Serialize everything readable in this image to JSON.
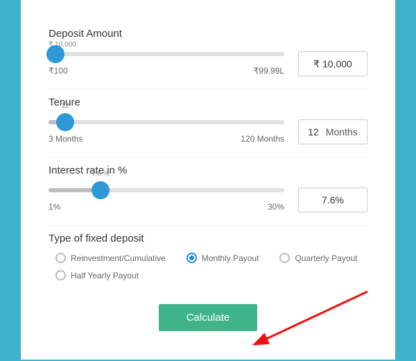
{
  "deposit": {
    "label": "Deposit Amount",
    "tooltip": "₹ 10,000",
    "min": "₹100",
    "max": "₹99.99L",
    "value": "₹ 10,000",
    "fillPct": 3,
    "thumbPct": 3
  },
  "tenure": {
    "label": "Tenure",
    "min": "3 Months",
    "max": "120 Months",
    "value": "12",
    "unit": "Months",
    "thumbVal": "12",
    "fillPct": 7,
    "thumbPct": 7
  },
  "rate": {
    "label": "Interest rate in %",
    "min": "1%",
    "max": "30%",
    "value": "7.6%",
    "thumbVal": "7.6 %",
    "fillPct": 22,
    "thumbPct": 22
  },
  "type": {
    "label": "Type of fixed deposit",
    "options": [
      "Reinvestment/Cumulative",
      "Monthly Payout",
      "Quarterly Payout",
      "Half Yearly Payout"
    ],
    "selected": 1
  },
  "button": "Calculate"
}
